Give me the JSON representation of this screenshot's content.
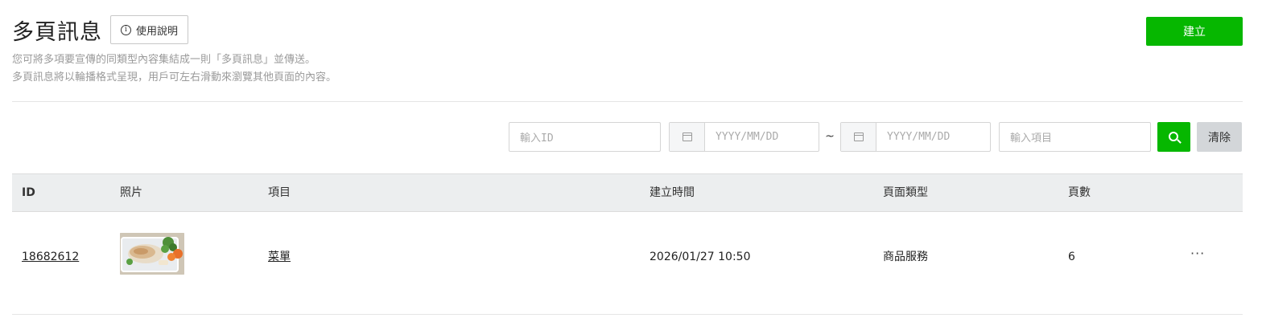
{
  "header": {
    "title": "多頁訊息",
    "help_label": "使用說明",
    "desc_line1": "您可將多項要宣傳的同類型內容集結成一則「多頁訊息」並傳送。",
    "desc_line2": "多頁訊息將以輪播格式呈現，用戶可左右滑動來瀏覽其他頁面的內容。",
    "create_label": "建立"
  },
  "filters": {
    "id_placeholder": "輸入ID",
    "date_from_placeholder": "YYYY/MM/DD",
    "date_separator": "~",
    "date_to_placeholder": "YYYY/MM/DD",
    "item_placeholder": "輸入項目",
    "clear_label": "清除"
  },
  "table": {
    "columns": [
      "ID",
      "照片",
      "項目",
      "建立時間",
      "頁面類型",
      "頁數"
    ],
    "rows": [
      {
        "id": "18682612",
        "item": "菜單",
        "created": "2026/01/27 10:50",
        "page_type": "商品服務",
        "pages": "6",
        "more": "···"
      }
    ]
  },
  "colors": {
    "primary_green": "#06b700",
    "header_bg": "#eceeef",
    "muted_text": "#9a9a9a"
  }
}
